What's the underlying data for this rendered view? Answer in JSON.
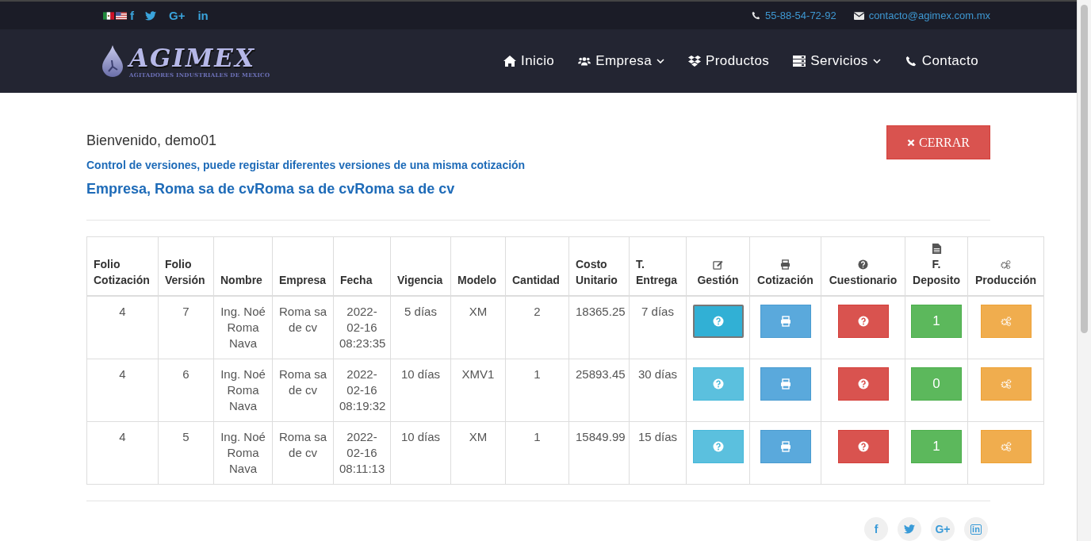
{
  "topbar": {
    "flags": [
      {
        "kind": "mexico"
      },
      {
        "kind": "usa"
      }
    ],
    "social": [
      {
        "kind": "facebook",
        "glyph": "f"
      },
      {
        "kind": "twitter"
      },
      {
        "kind": "googleplus",
        "glyph": "G+"
      },
      {
        "kind": "linkedin",
        "glyph": "in"
      }
    ],
    "phone": "55-88-54-72-92",
    "email": "contacto@agimex.com.mx"
  },
  "logo": {
    "name": "AGIMEX",
    "tagline": "AGITADORES INDUSTRIALES DE MEXICO"
  },
  "nav": [
    {
      "kind": "home",
      "label": "Inicio",
      "dropdown": false
    },
    {
      "kind": "users",
      "label": "Empresa",
      "dropdown": true
    },
    {
      "kind": "boxes",
      "label": "Productos",
      "dropdown": false
    },
    {
      "kind": "server",
      "label": "Servicios",
      "dropdown": true
    },
    {
      "kind": "phone",
      "label": "Contacto",
      "dropdown": false
    }
  ],
  "welcome": "Bienvenido, demo01",
  "close_button": "CERRAR",
  "subtitle": "Control de versiones, puede registar diferentes versiones de una misma cotización",
  "company_heading": "Empresa, Roma sa de cvRoma sa de cvRoma sa de cv",
  "table": {
    "columns": [
      {
        "label": "Folio Cotización"
      },
      {
        "label": "Folio Versión"
      },
      {
        "label": "Nombre"
      },
      {
        "label": "Empresa"
      },
      {
        "label": "Fecha"
      },
      {
        "label": "Vigencia"
      },
      {
        "label": "Modelo"
      },
      {
        "label": "Cantidad"
      },
      {
        "label": "Costo Unitario"
      },
      {
        "label": "T. Entrega"
      },
      {
        "label": "Gestión",
        "kind": "edit"
      },
      {
        "label": "Cotización",
        "kind": "print"
      },
      {
        "label": "Cuestionario",
        "kind": "question"
      },
      {
        "label": "F. Deposito",
        "kind": "file"
      },
      {
        "label": "Producción",
        "kind": "gears"
      }
    ],
    "rows": [
      {
        "cells": [
          "4",
          "7",
          "Ing. Noé Roma Nava",
          "Roma sa de cv",
          "2022-02-16 08:23:35",
          "5 días",
          "XM",
          "2",
          "18365.25",
          "7 días"
        ],
        "gestion_focused": true,
        "deposito": "1"
      },
      {
        "cells": [
          "4",
          "6",
          "Ing. Noé Roma Nava",
          "Roma sa de cv",
          "2022-02-16 08:19:32",
          "10 días",
          "XMV1",
          "1",
          "25893.45",
          "30 días"
        ],
        "gestion_focused": false,
        "deposito": "0"
      },
      {
        "cells": [
          "4",
          "5",
          "Ing. Noé Roma Nava",
          "Roma sa de cv",
          "2022-02-16 08:11:13",
          "10 días",
          "XM",
          "1",
          "15849.99",
          "15 días"
        ],
        "gestion_focused": false,
        "deposito": "1"
      }
    ]
  },
  "footer_social": [
    {
      "kind": "facebook",
      "glyph": "f"
    },
    {
      "kind": "twitter"
    },
    {
      "kind": "googleplus",
      "glyph": "G+"
    },
    {
      "kind": "linkedin",
      "glyph": "in"
    }
  ]
}
